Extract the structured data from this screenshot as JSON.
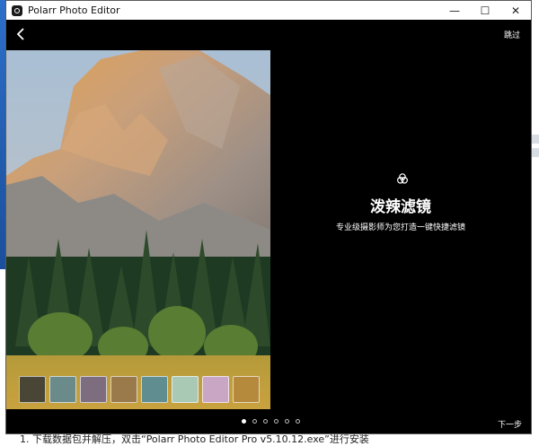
{
  "window": {
    "title": "Polarr Photo Editor",
    "minimize_glyph": "—",
    "maximize_glyph": "☐",
    "close_glyph": "✕"
  },
  "nav": {
    "back_icon": "chevron-left-icon",
    "skip_label": "跳过",
    "next_label": "下一步"
  },
  "feature": {
    "icon": "filter-circles-icon",
    "title": "泼辣滤镜",
    "description": "专业级摄影师为您打造一键快捷滤镜"
  },
  "filters": {
    "thumbnails": [
      {
        "name": "filter-1",
        "color": "#4a4636"
      },
      {
        "name": "filter-2",
        "color": "#6b8a8a"
      },
      {
        "name": "filter-3",
        "color": "#7d6d7e"
      },
      {
        "name": "filter-4",
        "color": "#9a7a4a"
      },
      {
        "name": "filter-5",
        "color": "#5f8d90"
      },
      {
        "name": "filter-6",
        "color": "#a9c9b5"
      },
      {
        "name": "filter-7",
        "color": "#c9a7c4"
      },
      {
        "name": "filter-8",
        "color": "#b58a3c"
      }
    ]
  },
  "pagination": {
    "count": 6,
    "active_index": 0
  },
  "background_doc": {
    "text": "1. 下载数据包并解压，双击“Polarr Photo Editor Pro v5.10.12.exe”进行安装"
  }
}
